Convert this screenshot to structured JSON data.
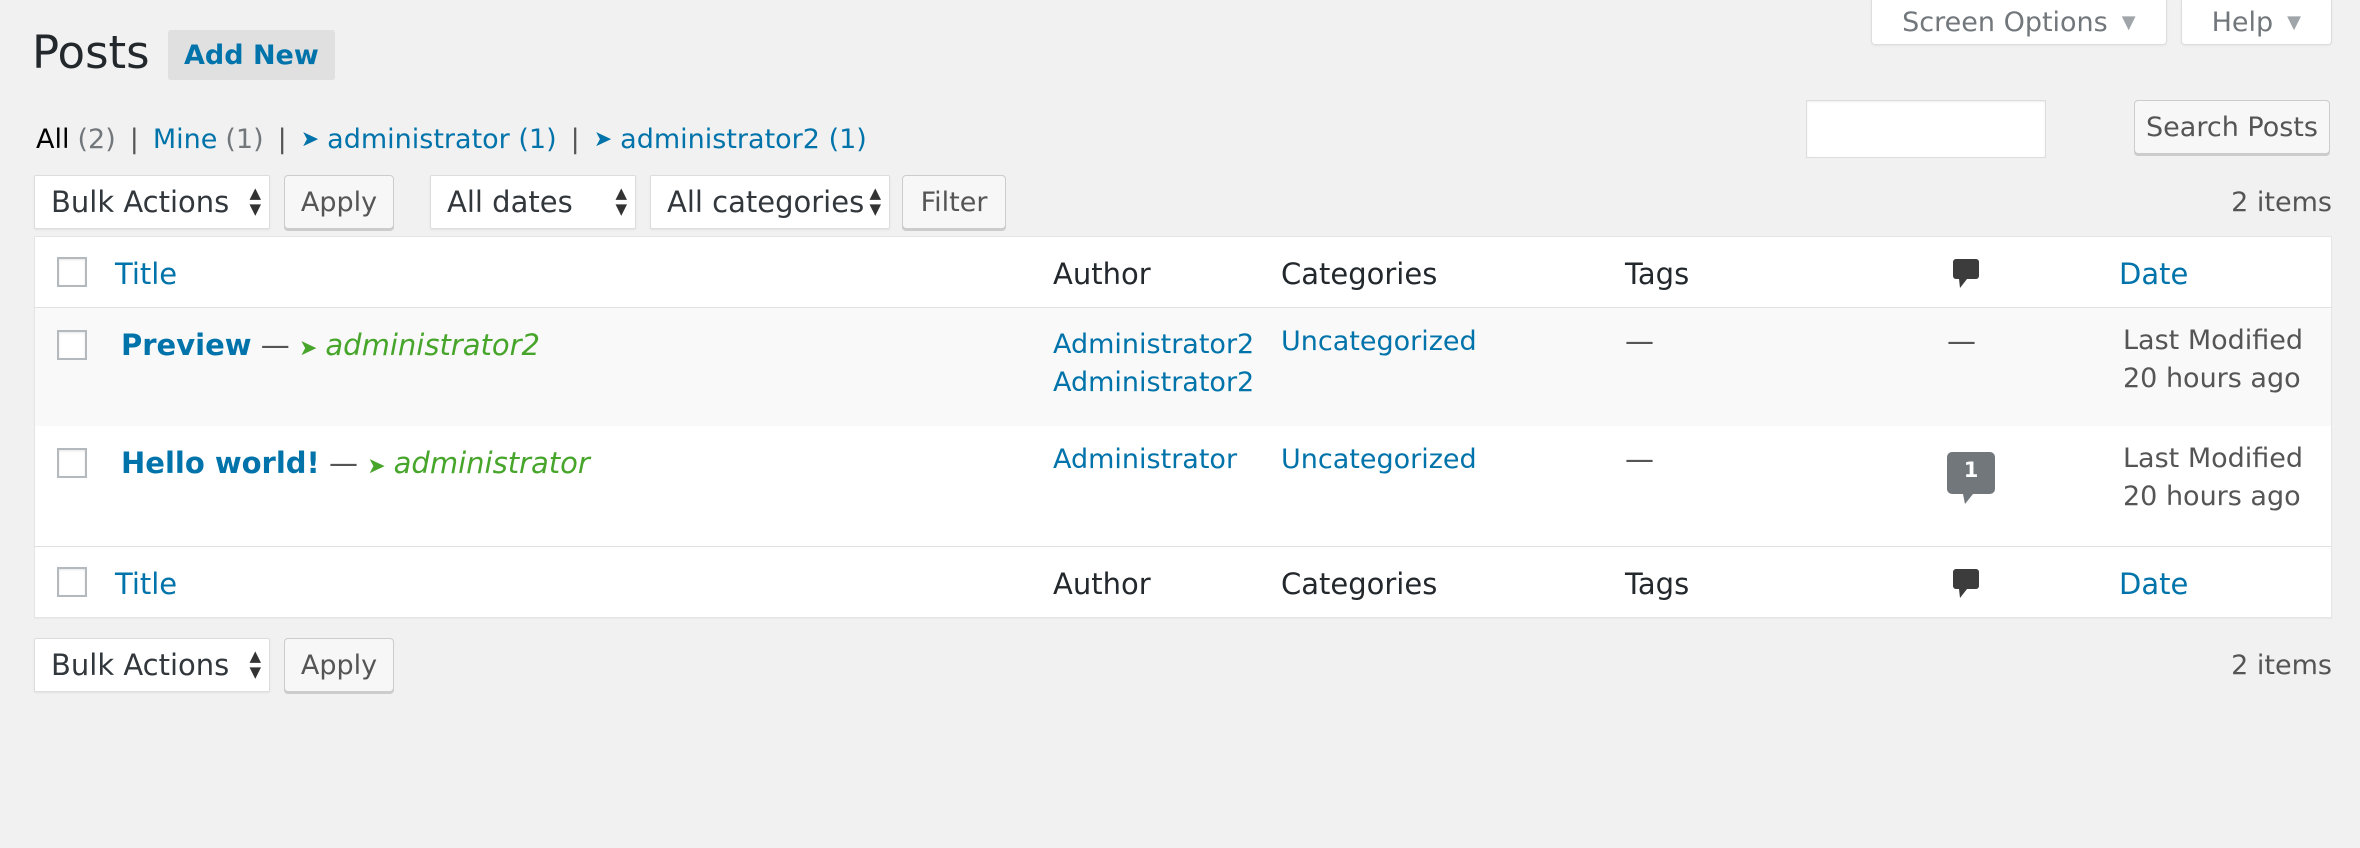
{
  "tabs": {
    "screen_options": "Screen Options",
    "help": "Help"
  },
  "header": {
    "title": "Posts",
    "add_new": "Add New"
  },
  "filters": {
    "all": {
      "label": "All",
      "count": "(2)"
    },
    "mine": {
      "label": "Mine",
      "count": "(1)"
    },
    "administrator": {
      "label": "administrator",
      "count": "(1)"
    },
    "administrator2": {
      "label": "administrator2",
      "count": "(1)"
    },
    "separator": "|"
  },
  "search": {
    "button": "Search Posts",
    "value": ""
  },
  "tablenav_top": {
    "bulk_actions": "Bulk Actions",
    "apply": "Apply",
    "dates": "All dates",
    "categories": "All categories",
    "filter": "Filter",
    "items": "2 items"
  },
  "table": {
    "columns": {
      "title": "Title",
      "author": "Author",
      "categories": "Categories",
      "tags": "Tags",
      "date": "Date"
    },
    "rows": [
      {
        "title": "Preview",
        "separator": "—",
        "draft_by": "administrator2",
        "author_line1": "Administrator2",
        "author_line2": "Administrator2",
        "category": "Uncategorized",
        "tags": "—",
        "comments": "—",
        "date_line1": "Last Modified",
        "date_line2": "20 hours ago"
      },
      {
        "title": "Hello world!",
        "separator": "—",
        "draft_by": "administrator",
        "author": "Administrator",
        "category": "Uncategorized",
        "tags": "—",
        "comments": "1",
        "date_line1": "Last Modified",
        "date_line2": "20 hours ago"
      }
    ]
  },
  "tablenav_bottom": {
    "bulk_actions": "Bulk Actions",
    "apply": "Apply",
    "items": "2 items"
  },
  "colors": {
    "link": "#0073aa",
    "draft": "#46a52a",
    "background": "#f1f1f1"
  },
  "icons": [
    "pin-icon",
    "comment-icon",
    "sort-arrows-icon",
    "caret-down-icon"
  ]
}
